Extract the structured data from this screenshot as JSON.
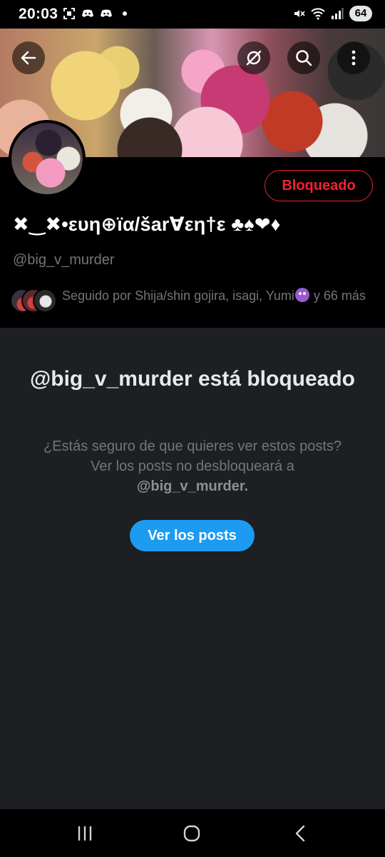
{
  "status_bar": {
    "time": "20:03",
    "battery": "64"
  },
  "profile": {
    "display_name": "✖‿✖•ευη⊕ïα/šar∀εη†ε ♣♠❤♦",
    "handle": "@big_v_murder",
    "blocked_button_label": "Bloqueado",
    "followers_text_before_emoji": "Seguido por Shija/shin gojira, isagi, Yumi",
    "followers_text_after_emoji": " y 66 más"
  },
  "blocked_panel": {
    "title": "@big_v_murder está bloqueado",
    "description_text": "¿Estás seguro de que quieres ver estos posts? Ver los posts no desbloqueará a ",
    "description_handle": "@big_v_murder.",
    "view_posts_label": "Ver los posts"
  },
  "icons": {
    "back": "arrow-left-icon",
    "grok": "grok-icon",
    "search": "search-icon",
    "more": "more-vertical-icon",
    "nav_recent": "recent-apps-icon",
    "nav_home": "home-icon",
    "nav_back": "nav-back-icon"
  },
  "colors": {
    "block_red": "#f4212e",
    "accent_blue": "#1d9bf0",
    "muted_text": "#71767b",
    "panel_bg": "#1d1f23"
  }
}
